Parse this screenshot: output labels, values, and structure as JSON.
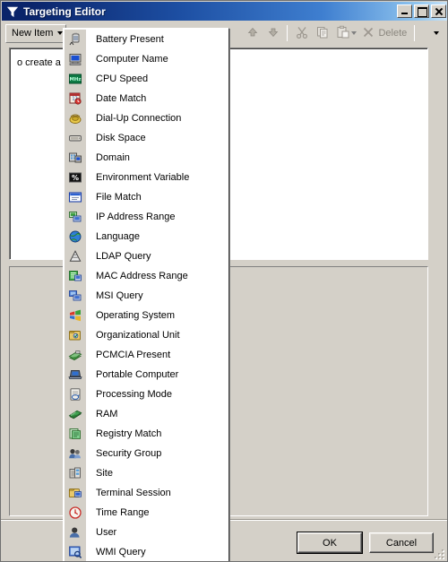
{
  "window": {
    "title": "Targeting Editor",
    "icon": "funnel-filter-icon",
    "controls": {
      "minimize": "Minimize",
      "maximize": "Maximize",
      "close": "Close"
    }
  },
  "toolbar": {
    "new_item_label": "New Item",
    "move_up": "Move Up",
    "move_down": "Move Down",
    "cut": "Cut",
    "copy": "Copy",
    "paste": "Paste",
    "delete_label": "Delete",
    "overflow": "Toolbar Options"
  },
  "main": {
    "hint_text": "o create a new targeting item"
  },
  "footer": {
    "ok_label": "OK",
    "cancel_label": "Cancel"
  },
  "menu": {
    "items": [
      {
        "label": "Battery Present",
        "icon": "battery-icon"
      },
      {
        "label": "Computer Name",
        "icon": "computer-icon"
      },
      {
        "label": "CPU Speed",
        "icon": "cpu-speed-icon"
      },
      {
        "label": "Date Match",
        "icon": "date-match-icon"
      },
      {
        "label": "Dial-Up Connection",
        "icon": "dialup-icon"
      },
      {
        "label": "Disk Space",
        "icon": "disk-space-icon"
      },
      {
        "label": "Domain",
        "icon": "domain-icon"
      },
      {
        "label": "Environment Variable",
        "icon": "environment-variable-icon"
      },
      {
        "label": "File Match",
        "icon": "file-match-icon"
      },
      {
        "label": "IP Address Range",
        "icon": "ip-address-range-icon"
      },
      {
        "label": "Language",
        "icon": "language-globe-icon"
      },
      {
        "label": "LDAP Query",
        "icon": "ldap-query-icon"
      },
      {
        "label": "MAC Address Range",
        "icon": "mac-address-range-icon"
      },
      {
        "label": "MSI Query",
        "icon": "msi-query-icon"
      },
      {
        "label": "Operating System",
        "icon": "operating-system-icon"
      },
      {
        "label": "Organizational Unit",
        "icon": "organizational-unit-icon"
      },
      {
        "label": "PCMCIA Present",
        "icon": "pcmcia-icon"
      },
      {
        "label": "Portable Computer",
        "icon": "portable-computer-icon"
      },
      {
        "label": "Processing Mode",
        "icon": "processing-mode-icon"
      },
      {
        "label": "RAM",
        "icon": "ram-icon"
      },
      {
        "label": "Registry Match",
        "icon": "registry-match-icon"
      },
      {
        "label": "Security Group",
        "icon": "security-group-icon"
      },
      {
        "label": "Site",
        "icon": "site-icon"
      },
      {
        "label": "Terminal Session",
        "icon": "terminal-session-icon"
      },
      {
        "label": "Time Range",
        "icon": "time-range-icon"
      },
      {
        "label": "User",
        "icon": "user-icon"
      },
      {
        "label": "WMI Query",
        "icon": "wmi-query-icon"
      }
    ]
  },
  "colors": {
    "title_start": "#0a246a",
    "title_end": "#c9e4f8",
    "face": "#d4d0c8",
    "panel": "#ffffff",
    "disabled_text": "#8a867e"
  }
}
